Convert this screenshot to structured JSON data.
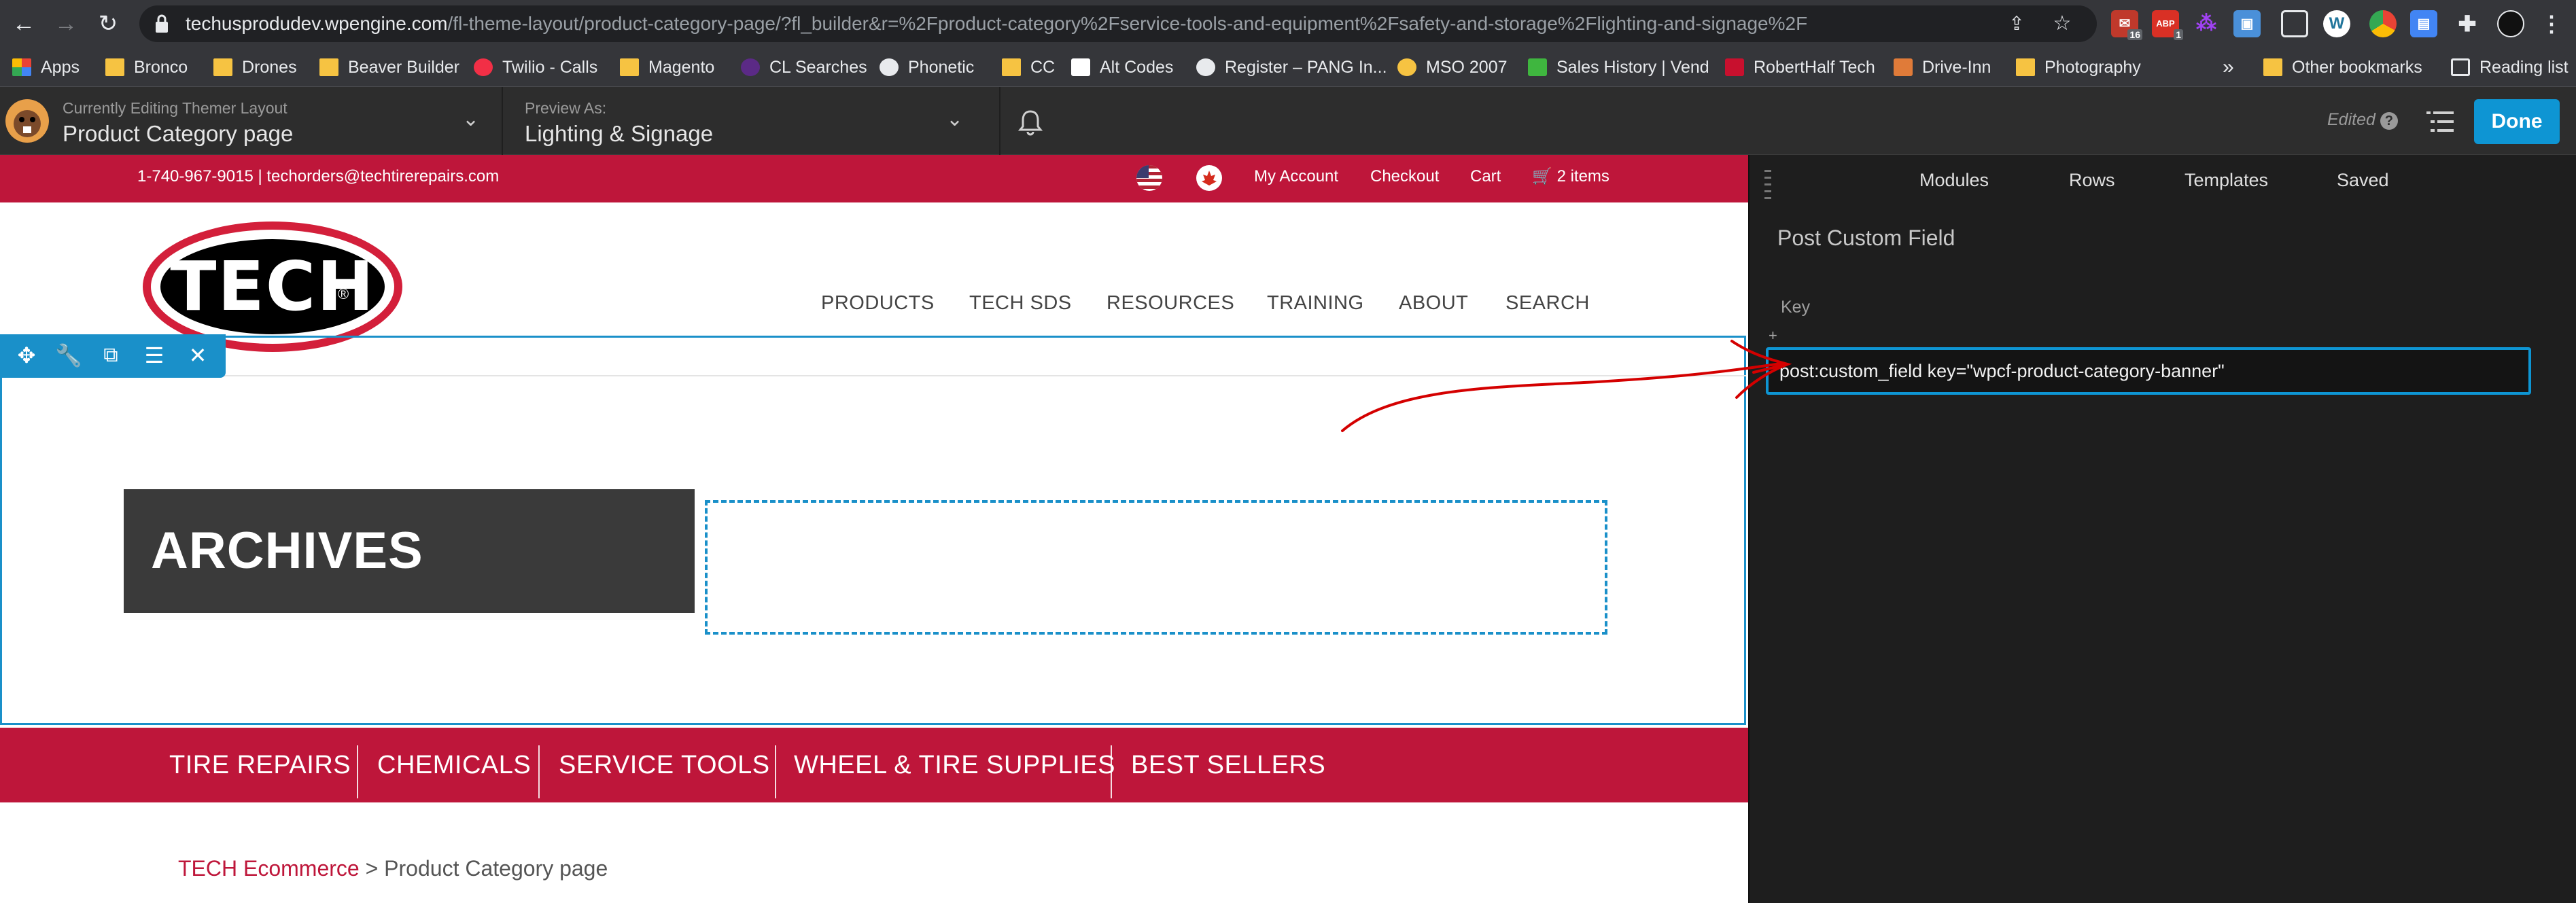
{
  "browser": {
    "url_host": "techusprodudev.wpengine.com",
    "url_path": "/fl-theme-layout/product-category-page/?fl_builder&r=%2Fproduct-category%2Fservice-tools-and-equipment%2Fsafety-and-storage%2Flighting-and-signage%2F",
    "ext_badge_1": "16",
    "ext_badge_2": "1",
    "bookmarks": [
      "Apps",
      "Bronco",
      "Drones",
      "Beaver Builder",
      "Twilio - Calls",
      "Magento",
      "CL Searches",
      "Phonetic",
      "CC",
      "Alt Codes",
      "Register – PANG In...",
      "MSO 2007",
      "Sales History | Vend",
      "RobertHalf Tech",
      "Drive-Inn",
      "Photography"
    ],
    "more_bookmarks": "»",
    "other_bookmarks": "Other bookmarks",
    "reading_list": "Reading list"
  },
  "builder_bar": {
    "editing_label": "Currently Editing Themer Layout",
    "editing_value": "Product Category page",
    "preview_label": "Preview As:",
    "preview_value": "Lighting & Signage",
    "edited": "Edited",
    "done": "Done"
  },
  "site": {
    "contact": "1-740-967-9015 | techorders@techtirerepairs.com",
    "top_links": [
      "My Account",
      "Checkout",
      "Cart"
    ],
    "cart_items": "2 items",
    "logo_text": "TECH",
    "logo_reg": "®",
    "nav": [
      "PRODUCTS",
      "TECH SDS",
      "RESOURCES",
      "TRAINING",
      "ABOUT",
      "SEARCH"
    ],
    "archives_title": "ARCHIVES",
    "categories": [
      "TIRE REPAIRS",
      "CHEMICALS",
      "SERVICE TOOLS",
      "WHEEL & TIRE SUPPLIES",
      "BEST SELLERS"
    ],
    "breadcrumb_link": "TECH Ecommerce",
    "breadcrumb_sep": " > ",
    "breadcrumb_current": "Product Category page"
  },
  "panel": {
    "tabs": [
      "Modules",
      "Rows",
      "Templates",
      "Saved"
    ],
    "title": "Post Custom Field",
    "key_label": "Key",
    "plus": "+",
    "field_value": "post:custom_field key=\"wpcf-product-category-banner\""
  },
  "colors": {
    "brand_red": "#be163a",
    "builder_blue": "#1a90c9",
    "done_blue": "#0e95d3"
  },
  "icons": {
    "back": "arrow-left-icon",
    "forward": "arrow-right-icon",
    "reload": "reload-icon",
    "lock": "lock-icon",
    "share": "share-icon",
    "star": "star-icon",
    "notifications": "bell-icon",
    "outline": "outline-list-icon",
    "help": "help-icon"
  }
}
